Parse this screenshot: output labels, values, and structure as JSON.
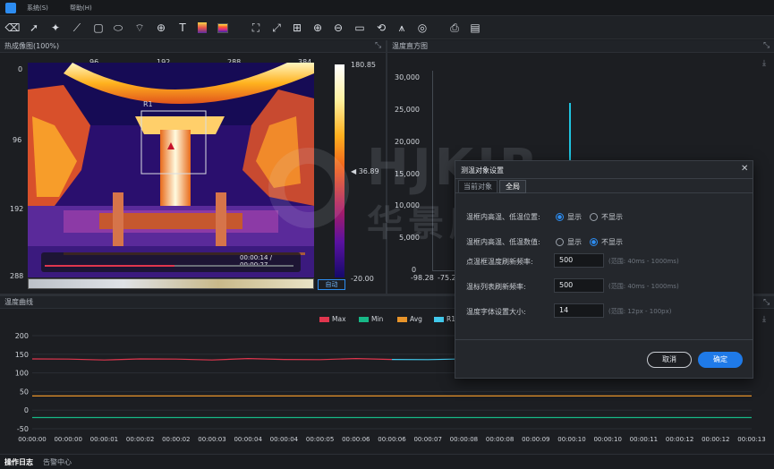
{
  "menu": {
    "system": "系统(S)",
    "help": "帮助(H)"
  },
  "icons": [
    "eraser-icon",
    "pointer-icon",
    "point-icon",
    "line-icon",
    "rectangle-icon",
    "ellipse-icon",
    "polygon-icon",
    "crosshair-icon",
    "text-icon",
    "palette-icon",
    "rainbow-icon",
    "fit-icon",
    "fullscreen-icon",
    "zoom-rect-icon",
    "zoom-in-icon",
    "zoom-out-icon",
    "screen-icon",
    "rotate-icon",
    "tripod-icon",
    "camera-icon",
    "print-icon",
    "save-icon"
  ],
  "thermal": {
    "title": "热成像图(100%)",
    "x_ticks": [
      "96",
      "192",
      "288",
      "384"
    ],
    "y_ticks": [
      "0",
      "96",
      "192",
      "288"
    ],
    "roi_label": "R1",
    "time": "00:00:14 / 00:00:27",
    "scale_max": "180.85",
    "scale_marker": "◀ 36.89",
    "scale_min": "-20.00",
    "auto_button": "自动"
  },
  "histogram": {
    "title": "温度直方图",
    "y_ticks": [
      "30,000",
      "25,000",
      "20,000",
      "15,000",
      "10,000",
      "5,000",
      "0"
    ],
    "x_ticks": [
      "-98.28",
      "-75.2"
    ],
    "spike_color": "#1fc3df"
  },
  "watermark": {
    "latin": "HJKIR",
    "cn": "华景康光电"
  },
  "curve": {
    "title": "温度曲线",
    "legend": [
      {
        "name": "Max",
        "color": "#e0364e"
      },
      {
        "name": "Min",
        "color": "#17b887"
      },
      {
        "name": "Avg",
        "color": "#e8942a"
      },
      {
        "name": "R1",
        "color": "#42c9ec"
      }
    ],
    "y_ticks": [
      "200",
      "150",
      "100",
      "50",
      "0",
      "-50"
    ],
    "x_ticks": [
      "00:00:00",
      "00:00:00",
      "00:00:01",
      "00:00:02",
      "00:00:02",
      "00:00:03",
      "00:00:04",
      "00:00:04",
      "00:00:05",
      "00:00:06",
      "00:00:06",
      "00:00:07",
      "00:00:08",
      "00:00:08",
      "00:00:09",
      "00:00:10",
      "00:00:10",
      "00:00:11",
      "00:00:12",
      "00:00:12",
      "00:00:13"
    ]
  },
  "chart_data": {
    "type": "line",
    "ylim": [
      -50,
      200
    ],
    "x": [
      "00:00:00",
      "00:00:00",
      "00:00:01",
      "00:00:02",
      "00:00:02",
      "00:00:03",
      "00:00:04",
      "00:00:04",
      "00:00:05",
      "00:00:06",
      "00:00:06",
      "00:00:07",
      "00:00:08",
      "00:00:08",
      "00:00:09",
      "00:00:10",
      "00:00:10",
      "00:00:11",
      "00:00:12",
      "00:00:12",
      "00:00:13"
    ],
    "series": [
      {
        "name": "Max",
        "values": [
          136,
          137,
          136,
          136,
          137,
          136,
          137,
          136,
          137,
          137,
          136,
          137,
          136,
          137,
          136,
          137,
          136,
          137,
          136,
          137,
          136
        ]
      },
      {
        "name": "Min",
        "values": [
          -20,
          -20,
          -20,
          -20,
          -20,
          -20,
          -20,
          -20,
          -20,
          -20,
          -20,
          -20,
          -20,
          -20,
          -20,
          -20,
          -20,
          -20,
          -20,
          -20,
          -20
        ]
      },
      {
        "name": "Avg",
        "values": [
          38,
          38,
          38,
          38,
          38,
          38,
          38,
          38,
          38,
          38,
          38,
          38,
          38,
          38,
          38,
          38,
          38,
          38,
          38,
          38,
          38
        ]
      },
      {
        "name": "R1",
        "values": [
          136,
          137,
          136,
          136,
          137,
          136,
          137,
          136,
          137,
          137,
          136,
          137,
          136,
          137,
          136,
          137,
          136,
          137,
          136,
          137,
          136
        ]
      }
    ]
  },
  "dialog": {
    "title": "测温对象设置",
    "tabs": [
      "当前对象",
      "全局"
    ],
    "row1": {
      "label": "温框内高温、低温位置:",
      "show": "显示",
      "hide": "不显示"
    },
    "row2": {
      "label": "温框内高温、低温数值:",
      "show": "显示",
      "hide": "不显示"
    },
    "row3": {
      "label": "点温框温度刷新频率:",
      "value": "500",
      "hint": "(范围: 40ms - 1000ms)"
    },
    "row4": {
      "label": "温标列表刷新频率:",
      "value": "500",
      "hint": "(范围: 40ms - 1000ms)"
    },
    "row5": {
      "label": "温度字体设置大小:",
      "value": "14",
      "hint": "(范围: 12px - 100px)"
    },
    "cancel": "取消",
    "ok": "确定"
  },
  "footer": {
    "tab1": "操作日志",
    "tab2": "告警中心"
  }
}
